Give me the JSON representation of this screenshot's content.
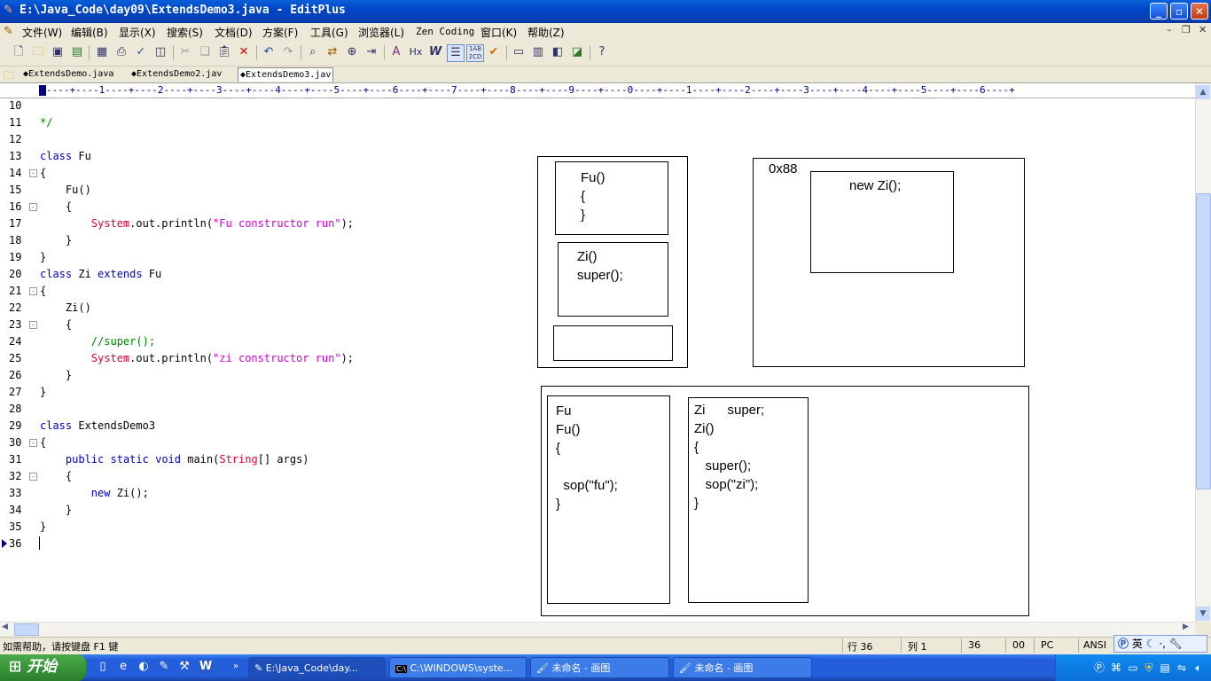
{
  "window": {
    "title": "E:\\Java_Code\\day09\\ExtendsDemo3.java - EditPlus",
    "buttons": {
      "minimize": "_",
      "maximize": "▫",
      "close": "✕"
    }
  },
  "menu": [
    "文件(W)",
    "编辑(B)",
    "显示(X)",
    "搜索(S)",
    "文档(D)",
    "方案(F)",
    "工具(G)",
    "浏览器(L)",
    "Zen Coding",
    "窗口(K)",
    "帮助(Z)"
  ],
  "mdi_buttons": {
    "minimize": "–",
    "restore": "❐",
    "close": "✕"
  },
  "toolbar_icons": [
    "new-file-icon",
    "open-folder-icon",
    "save-icon",
    "save-all-icon",
    "print-preview-icon",
    "print-icon",
    "spell-check-icon",
    "save-browser-icon",
    "cut-icon",
    "copy-icon",
    "paste-icon",
    "delete-icon",
    "undo-icon",
    "redo-icon",
    "find-icon",
    "replace-icon",
    "find-in-files-icon",
    "goto-line-icon",
    "font-icon",
    "html-heading-icon",
    "word-wrap-icon",
    "line-number-icon",
    "column-select-icon",
    "checkmark-icon",
    "view-icon",
    "clip-icon",
    "directory-icon",
    "snippet-icon",
    "help-icon"
  ],
  "tabs": [
    {
      "label": "ExtendsDemo.java",
      "active": false
    },
    {
      "label": "ExtendsDemo2.jav",
      "active": false
    },
    {
      "label": "ExtendsDemo3.jav",
      "active": true
    }
  ],
  "ruler": "----+----1----+----2----+----3----+----4----+----5----+----6----+----7----+----8----+----9----+----0----+----1----+----2----+----3----+----4----+----5----+----6----+",
  "code_lines": [
    {
      "n": "10",
      "fold": "",
      "parts": []
    },
    {
      "n": "11",
      "fold": "",
      "parts": [
        {
          "t": "*/",
          "c": "cmt"
        }
      ]
    },
    {
      "n": "12",
      "fold": "",
      "parts": []
    },
    {
      "n": "13",
      "fold": "",
      "parts": [
        {
          "t": "class",
          "c": "kw"
        },
        {
          "t": " Fu",
          "c": ""
        }
      ]
    },
    {
      "n": "14",
      "fold": "⊟",
      "parts": [
        {
          "t": "{",
          "c": ""
        }
      ]
    },
    {
      "n": "15",
      "fold": "",
      "parts": [
        {
          "t": "    Fu()",
          "c": ""
        }
      ]
    },
    {
      "n": "16",
      "fold": "⊟",
      "parts": [
        {
          "t": "    {",
          "c": ""
        }
      ]
    },
    {
      "n": "17",
      "fold": "",
      "parts": [
        {
          "t": "        ",
          "c": ""
        },
        {
          "t": "System",
          "c": "cls"
        },
        {
          "t": ".out.println(",
          "c": ""
        },
        {
          "t": "\"Fu constructor run\"",
          "c": "str"
        },
        {
          "t": ");",
          "c": ""
        }
      ]
    },
    {
      "n": "18",
      "fold": "",
      "parts": [
        {
          "t": "    }",
          "c": ""
        }
      ]
    },
    {
      "n": "19",
      "fold": "",
      "parts": [
        {
          "t": "}",
          "c": ""
        }
      ]
    },
    {
      "n": "20",
      "fold": "",
      "parts": [
        {
          "t": "class",
          "c": "kw"
        },
        {
          "t": " Zi ",
          "c": ""
        },
        {
          "t": "extends",
          "c": "kw"
        },
        {
          "t": " Fu",
          "c": ""
        }
      ]
    },
    {
      "n": "21",
      "fold": "⊟",
      "parts": [
        {
          "t": "{",
          "c": ""
        }
      ]
    },
    {
      "n": "22",
      "fold": "",
      "parts": [
        {
          "t": "    Zi()",
          "c": ""
        }
      ]
    },
    {
      "n": "23",
      "fold": "⊟",
      "parts": [
        {
          "t": "    {",
          "c": ""
        }
      ]
    },
    {
      "n": "24",
      "fold": "",
      "parts": [
        {
          "t": "        ",
          "c": ""
        },
        {
          "t": "//super();",
          "c": "cmt"
        }
      ]
    },
    {
      "n": "25",
      "fold": "",
      "parts": [
        {
          "t": "        ",
          "c": ""
        },
        {
          "t": "System",
          "c": "cls"
        },
        {
          "t": ".out.println(",
          "c": ""
        },
        {
          "t": "\"zi constructor run\"",
          "c": "str"
        },
        {
          "t": ");",
          "c": ""
        }
      ]
    },
    {
      "n": "26",
      "fold": "",
      "parts": [
        {
          "t": "    }",
          "c": ""
        }
      ]
    },
    {
      "n": "27",
      "fold": "",
      "parts": [
        {
          "t": "}",
          "c": ""
        }
      ]
    },
    {
      "n": "28",
      "fold": "",
      "parts": []
    },
    {
      "n": "29",
      "fold": "",
      "parts": [
        {
          "t": "class",
          "c": "kw"
        },
        {
          "t": " ExtendsDemo3",
          "c": ""
        }
      ]
    },
    {
      "n": "30",
      "fold": "⊟",
      "parts": [
        {
          "t": "{",
          "c": ""
        }
      ]
    },
    {
      "n": "31",
      "fold": "",
      "parts": [
        {
          "t": "    ",
          "c": ""
        },
        {
          "t": "public",
          "c": "kw"
        },
        {
          "t": " ",
          "c": ""
        },
        {
          "t": "static",
          "c": "kw"
        },
        {
          "t": " ",
          "c": ""
        },
        {
          "t": "void",
          "c": "kw"
        },
        {
          "t": " main(",
          "c": ""
        },
        {
          "t": "String",
          "c": "cls"
        },
        {
          "t": "[] args)",
          "c": ""
        }
      ]
    },
    {
      "n": "32",
      "fold": "⊟",
      "parts": [
        {
          "t": "    {",
          "c": ""
        }
      ]
    },
    {
      "n": "33",
      "fold": "",
      "parts": [
        {
          "t": "        ",
          "c": ""
        },
        {
          "t": "new",
          "c": "kw"
        },
        {
          "t": " Zi();",
          "c": ""
        }
      ]
    },
    {
      "n": "34",
      "fold": "",
      "parts": [
        {
          "t": "    }",
          "c": ""
        }
      ]
    },
    {
      "n": "35",
      "fold": "",
      "parts": [
        {
          "t": "}",
          "c": ""
        }
      ]
    },
    {
      "n": "36",
      "fold": "",
      "parts": []
    }
  ],
  "diagram": {
    "stack_fu": "Fu()\n{\n}",
    "stack_zi": "Zi()\nsuper();",
    "heap_address": "0x88",
    "heap_object": "new Zi();",
    "method_fu": "Fu\nFu()\n{\n\n  sop(\"fu\");\n}",
    "method_zi": "Zi      super;\nZi()\n{\n   super();\n   sop(\"zi\");\n}"
  },
  "status": {
    "help": "如需帮助，请按键盘 F1 键",
    "line": "行 36",
    "col": "列 1",
    "num": "36",
    "hex": "00",
    "mode": "PC",
    "encoding": "ANSI"
  },
  "ime": "英",
  "taskbar": {
    "start": "开始",
    "tasks": [
      {
        "label": "E:\\Java_Code\\day...",
        "icon": "editplus-icon",
        "active": true
      },
      {
        "label": "C:\\WINDOWS\\syste...",
        "icon": "cmd-icon",
        "active": false
      },
      {
        "label": "未命名 - 画图",
        "icon": "paint-icon",
        "active": false
      },
      {
        "label": "未命名 - 画图",
        "icon": "paint-icon",
        "active": false
      }
    ]
  }
}
